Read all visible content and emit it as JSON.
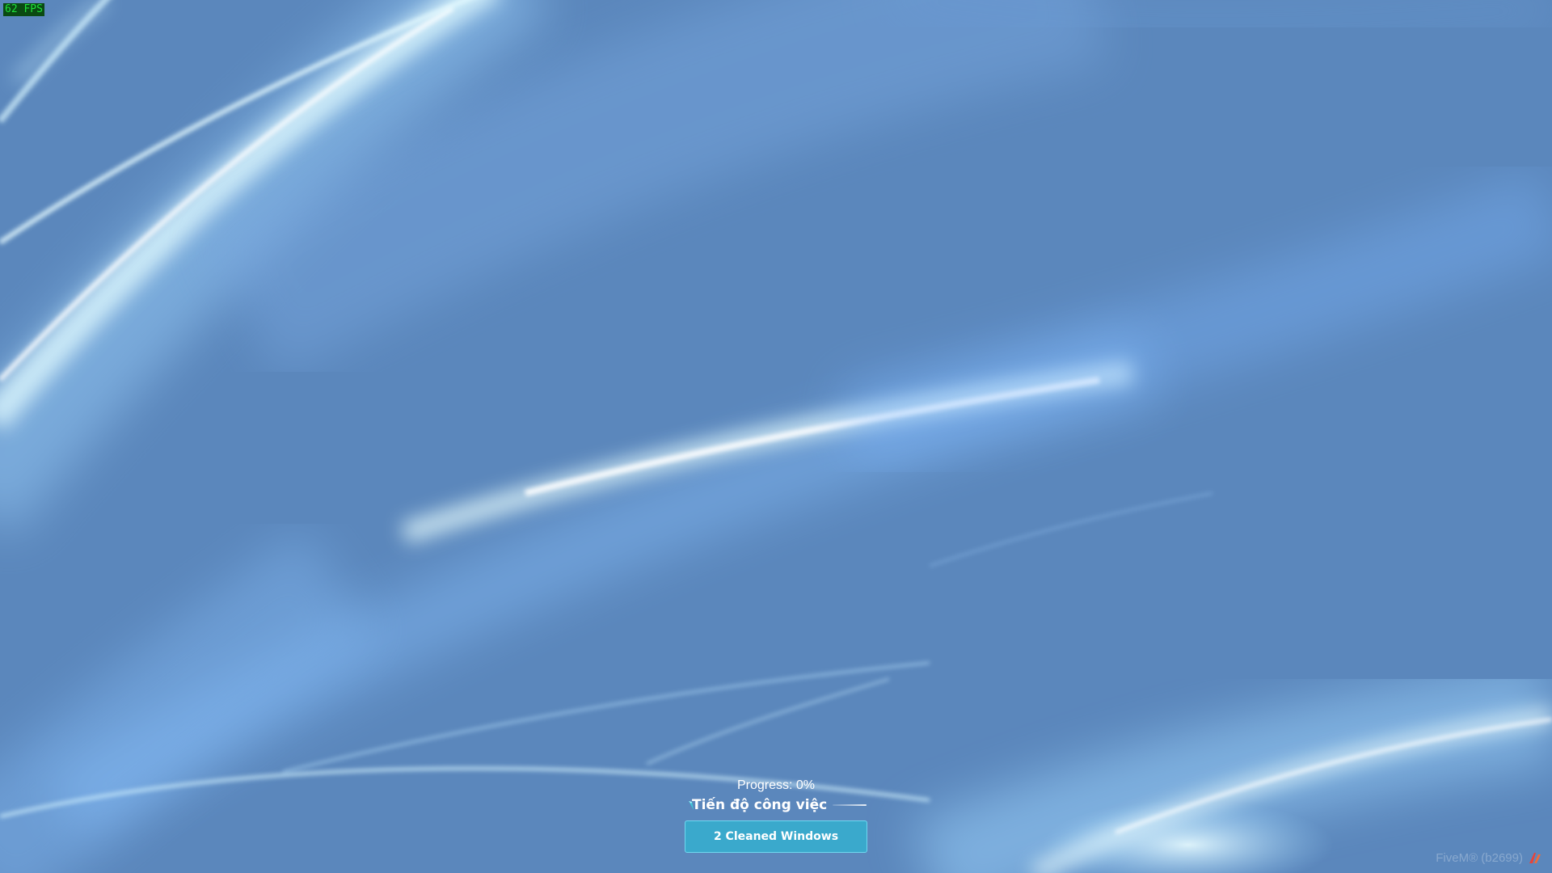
{
  "overlay": {
    "fps_counter": "62 FPS"
  },
  "loading": {
    "progress_text": "Progress: 0%",
    "task_title": "Tiến độ công việc",
    "button_label": "2 Cleaned Windows"
  },
  "branding": {
    "client_version": "FiveM® (b2699)"
  },
  "icons": {
    "spinner": "spinner-icon",
    "logo": "fivem-logo"
  },
  "colors": {
    "background": "#5b87bc",
    "button_background": "#3aa9cc",
    "button_border": "#6fd8f0",
    "fps_text": "#1ee23a",
    "fps_background": "#0a4a12",
    "logo": "#e8433a"
  }
}
